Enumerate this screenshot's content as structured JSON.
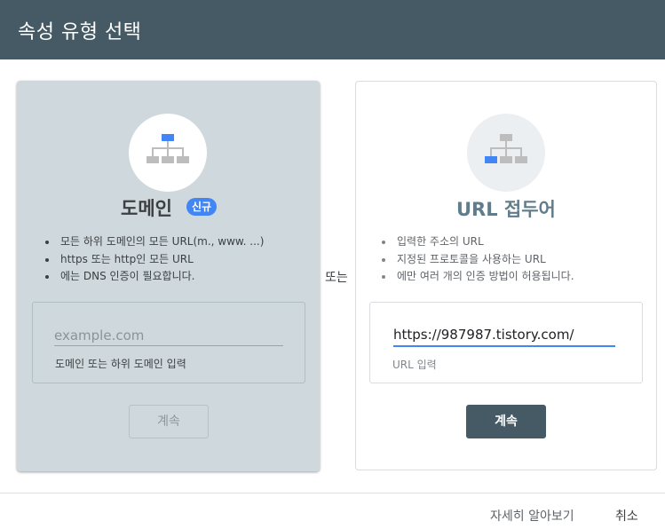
{
  "dialog": {
    "title": "속성 유형 선택"
  },
  "domain_card": {
    "title": "도메인",
    "badge": "신규",
    "bullets": [
      "모든 하위 도메인의 모든 URL(m., www. ...)",
      "https 또는 http인 모든 URL",
      "에는 DNS 인증이 필요합니다."
    ],
    "input_placeholder": "example.com",
    "input_value": "",
    "helper": "도메인 또는 하위 도메인 입력",
    "button_label": "계속",
    "icon": "sitemap-icon"
  },
  "separator_text": "또는",
  "url_card": {
    "title": "URL 접두어",
    "bullets": [
      "입력한 주소의 URL",
      "지정된 프로토콜을 사용하는 URL",
      "에만 여러 개의 인증 방법이 허용됩니다."
    ],
    "input_value": "https://987987.tistory.com/",
    "helper": "URL 입력",
    "button_label": "계속",
    "icon": "sitemap-icon"
  },
  "footer": {
    "learn_more": "자세히 알아보기",
    "cancel": "취소"
  },
  "colors": {
    "header_bg": "#455a64",
    "domain_card_bg": "#cfd8dc",
    "accent_blue": "#4285f4",
    "primary_button": "#455a64"
  }
}
